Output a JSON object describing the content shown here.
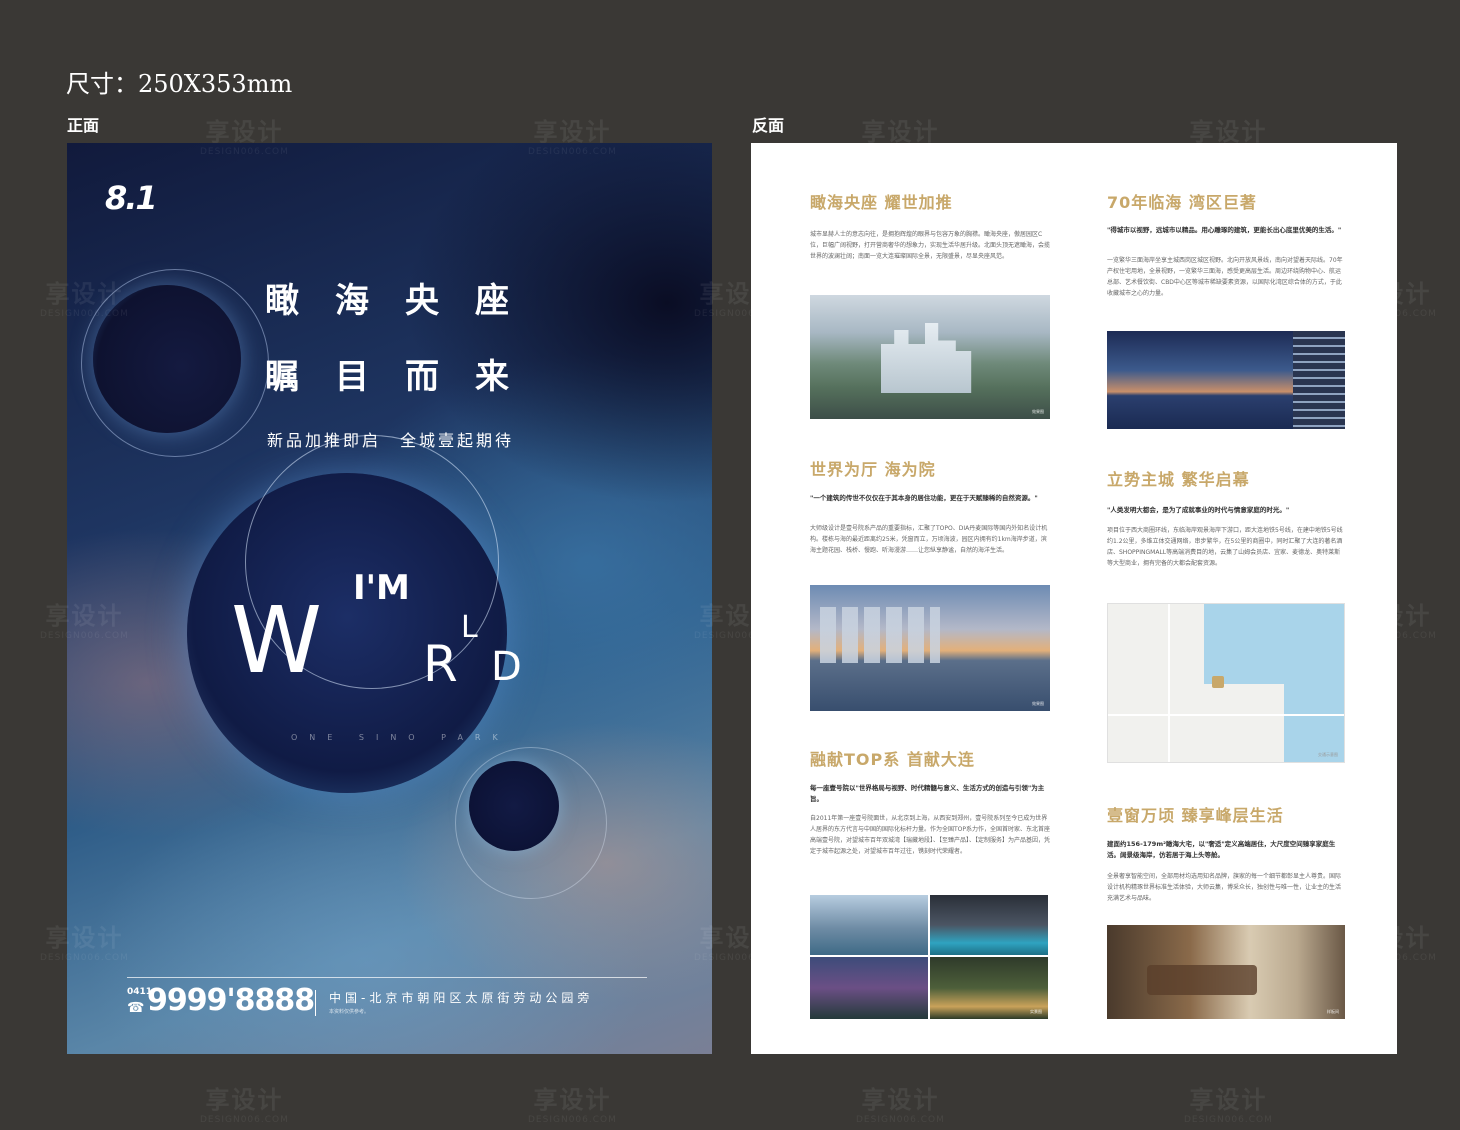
{
  "header": {
    "size_label": "尺寸：250X353mm",
    "front_label": "正面",
    "back_label": "反面"
  },
  "watermark": {
    "text": "享设计",
    "sub": "DESIGN006.COM"
  },
  "front": {
    "logo": "8.1",
    "headline_1": "瞰海央座",
    "headline_2": "瞩目而来",
    "subline": "新品加推即启　全城壹起期待",
    "world_im": "I'M",
    "world_w": "W",
    "world_r": "R",
    "world_l": "L",
    "world_d": "D",
    "tagline": "ONE SINO PARK",
    "phone_prefix": "0411",
    "phone_icon": "phone-icon",
    "phone": "9999'8888",
    "address": "中国-北京市朝阳区太原街劳动公园旁",
    "disclaimer": "本资料仅供参考。"
  },
  "back": {
    "sections": [
      {
        "title": "瞰海央座 耀世加推",
        "quote": "",
        "body": "城市显赫人士的意志向往，是拥抱辉煌的眼界与包容万象的胸襟。瞰海央座，傲居园区C位，巨幅广阔视野，打开营商奢华的想象力，实现生活华居升级。北面头顶无遮瞰海，会揽世界的波澜壮阔；南面一览大连璀璨国际全景，无限盛景，尽显央座风范。",
        "photo_caption": "效果图"
      },
      {
        "title": "70年临海 湾区巨著",
        "quote": "\"得城市以视野，远城市以精品。用心雕琢的建筑，更能长出心底里优美的生活。\"",
        "body": "一览繁华三面海岸坐享主城西岗区城区视野。北向开放风景线，南向对望着天际线。70年产权住宅用地，全景视野，一览繁华三面海，感受更高层生活。周边环绕购物中心、航运总部、艺术餐饮街、CBD中心区等城市稀缺要素资源，以国际化湾区综合体的方式，于此收藏城市之心的力量。",
        "photo_caption": ""
      },
      {
        "title": "世界为厅 海为院",
        "quote": "\"一个建筑的传世不仅仅在于其本身的居住功能，更在于天赋臻稀的自然资源。\"",
        "body": "大师级设计是壹号院系产品的重要指标，汇聚了TOPO、DIA丹麦国际等国内外知名设计机构。楼栋与海的最近距离约25米，凭窗而立，万顷海波，园区内拥有约1km海岸步道，滨海主题花园、栈桥、慢跑、听海漫游……让您纵享静谧，自然的海洋生活。",
        "photo_caption": "效果图"
      },
      {
        "title": "立势主城 繁华启幕",
        "quote": "\"人类发明大都会，是为了成就事业的时代与情意家庭的时光。\"",
        "body": "项目位于西大商圈环线，东临海岸观景海岸下游口，距大连地铁5号线，在建中地铁5号线约1.2公里，多维立体交通网络，串步繁华，在5公里的商圈中，同时汇聚了大连的著名酒店、SHOPPINGMALL等高端消费目的地，云集了山姆会员店、宜家、麦德龙、奥特莱斯等大型商业，拥有完备的大都会配套资源。",
        "photo_caption": "交通示意图"
      },
      {
        "title": "融献TOP系 首献大连",
        "quote": "每一座壹号院以\"世界格局与视野、时代精髓与意义、生活方式的创造与引领\"为主旨。",
        "body": "自2011年第一座壹号院面世，从北京到上海，从西安到郑州，壹号院系列至今已成为世界人居界的东方代言与中国的国际化标杆力量。作为全国TOP系力作，全国首时家、东北首座高端壹号院，对望城市百年双城湾【瑞藏地段】、【至臻产品】、【定制服务】为产品基因，凭定于城市起源之处，对望城市百年过往，镌刻时代荣耀者。",
        "photo_caption": "实景图"
      },
      {
        "title": "壹窗万顷 臻享峰层生活",
        "quote": "建面约156-179m²瞰海大宅，以\"奢适\"定义高端居住，大尺度空间臻享家庭生活。阔景级海岸，仿若居于海上头等舱。",
        "body": "全景奢享智能空间，全部用材均选用知名品牌，旗家的每一个细节都彰显主人尊贵。国际设计机构精琢世界标准生活体验，大师云集，博采众长，独创性与唯一性，让业主的生活充满艺术与品味。",
        "photo_caption": "样板间"
      }
    ]
  }
}
